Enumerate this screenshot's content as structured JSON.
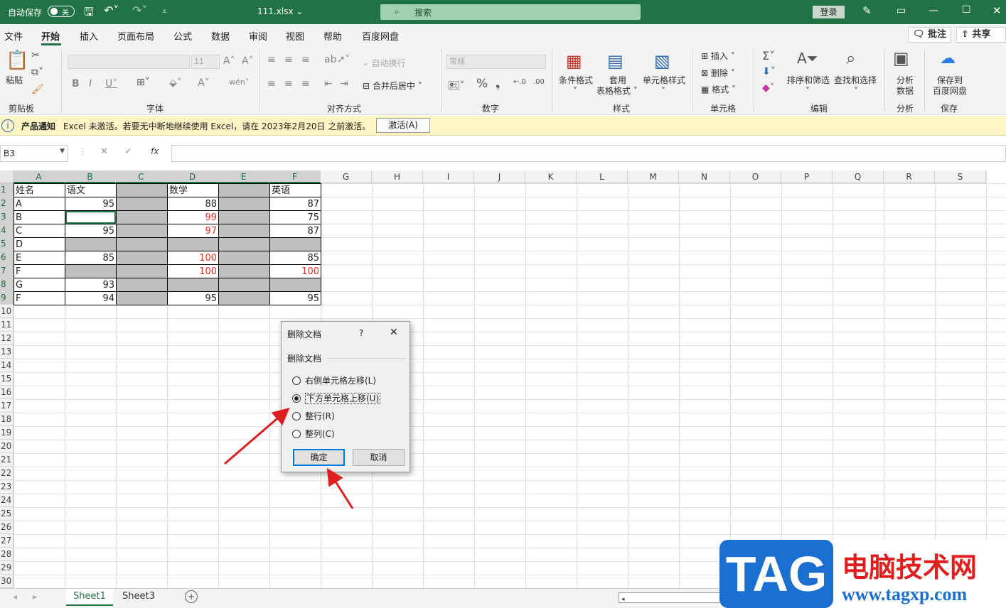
{
  "titlebar": {
    "autosave_label": "自动保存",
    "autosave_state": "关",
    "filename": "111.xlsx",
    "search_placeholder": "搜索",
    "login_label": "登录"
  },
  "menu": {
    "items": [
      "文件",
      "开始",
      "插入",
      "页面布局",
      "公式",
      "数据",
      "审阅",
      "视图",
      "帮助",
      "百度网盘"
    ],
    "active": "开始",
    "comment_label": "批注",
    "share_label": "共享"
  },
  "ribbon": {
    "clipboard": {
      "paste": "粘贴",
      "group": "剪贴板"
    },
    "font": {
      "size": "11",
      "group": "字体"
    },
    "align": {
      "wrap": "自动换行",
      "merge": "合并后居中",
      "group": "对齐方式"
    },
    "number": {
      "format": "常规",
      "group": "数字"
    },
    "styles": {
      "cond": "条件格式",
      "table1": "套用",
      "table2": "表格格式",
      "cell": "单元格样式",
      "group": "样式"
    },
    "cells": {
      "insert": "插入",
      "delete": "删除",
      "format": "格式",
      "group": "单元格"
    },
    "editing": {
      "sort": "排序和筛选",
      "find": "查找和选择",
      "group": "编辑"
    },
    "analysis": {
      "btn1": "分析",
      "btn2": "数据",
      "group": "分析"
    },
    "save": {
      "btn1": "保存到",
      "btn2": "百度网盘",
      "group": "保存"
    }
  },
  "notification": {
    "title": "产品通知",
    "message": "Excel 未激活。若要无中断地继续使用 Excel，请在 2023年2月20日 之前激活。",
    "button": "激活(A)"
  },
  "formula_bar": {
    "name_box": "B3",
    "fx": "fx",
    "value": ""
  },
  "columns": [
    "A",
    "B",
    "C",
    "D",
    "E",
    "F",
    "G",
    "H",
    "I",
    "J",
    "K",
    "L",
    "M",
    "N",
    "O",
    "P",
    "Q",
    "R",
    "S"
  ],
  "rows": [
    "1",
    "2",
    "3",
    "4",
    "5",
    "6",
    "7",
    "8",
    "9",
    "10",
    "11",
    "12",
    "13",
    "14",
    "15",
    "16",
    "17",
    "18",
    "19",
    "20",
    "21",
    "22",
    "23",
    "24",
    "25",
    "26",
    "27",
    "28",
    "29",
    "30"
  ],
  "sheet": {
    "headers": {
      "A": "姓名",
      "B": "语文",
      "D": "数学",
      "F": "英语"
    },
    "names": [
      "A",
      "B",
      "C",
      "D",
      "E",
      "F",
      "G",
      "F"
    ],
    "B": [
      "95",
      "",
      "95",
      "",
      "85",
      "",
      "93",
      "94"
    ],
    "D": [
      "88",
      "99",
      "97",
      "",
      "100",
      "100",
      "",
      "95"
    ],
    "F": [
      "87",
      "75",
      "87",
      "",
      "85",
      "100",
      "",
      "95"
    ]
  },
  "sheet_tabs": {
    "tabs": [
      "Sheet1",
      "Sheet3"
    ],
    "active": "Sheet1"
  },
  "dialog": {
    "title": "删除文档",
    "help": "?",
    "section": "删除文档",
    "options": [
      "右侧单元格左移(L)",
      "下方单元格上移(U)",
      "整行(R)",
      "整列(C)"
    ],
    "selected_option": 1,
    "ok": "确定",
    "cancel": "取消"
  },
  "watermark": {
    "tag": "TAG",
    "title": "电脑技术网",
    "url": "www.tagxp.com"
  },
  "colors": {
    "excel_green": "#217346",
    "red_value": "#e0302a",
    "gray_fill": "#bfbfbf",
    "arrow": "#e02020"
  }
}
